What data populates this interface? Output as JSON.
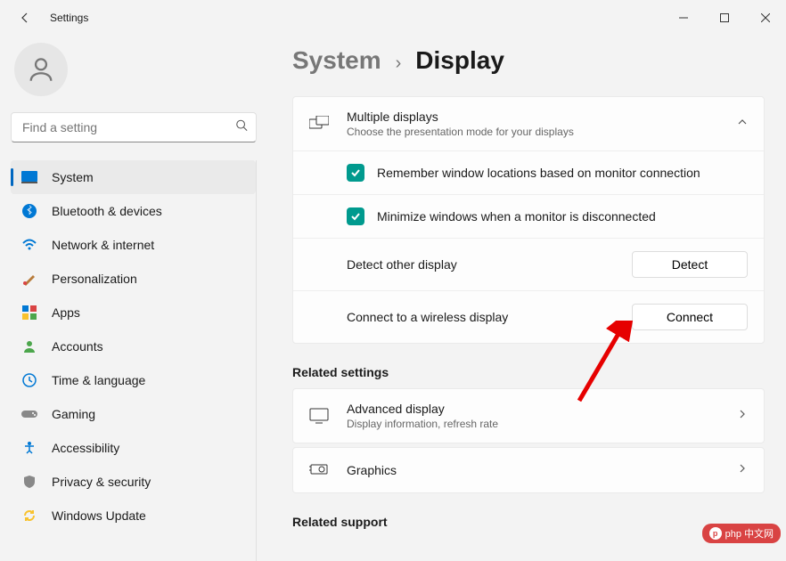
{
  "window": {
    "title": "Settings"
  },
  "search": {
    "placeholder": "Find a setting"
  },
  "nav": {
    "items": [
      {
        "label": "System"
      },
      {
        "label": "Bluetooth & devices"
      },
      {
        "label": "Network & internet"
      },
      {
        "label": "Personalization"
      },
      {
        "label": "Apps"
      },
      {
        "label": "Accounts"
      },
      {
        "label": "Time & language"
      },
      {
        "label": "Gaming"
      },
      {
        "label": "Accessibility"
      },
      {
        "label": "Privacy & security"
      },
      {
        "label": "Windows Update"
      }
    ]
  },
  "breadcrumb": {
    "parent": "System",
    "current": "Display"
  },
  "multi": {
    "title": "Multiple displays",
    "sub": "Choose the presentation mode for your displays",
    "remember": "Remember window locations based on monitor connection",
    "minimize": "Minimize windows when a monitor is disconnected",
    "detect_label": "Detect other display",
    "detect_btn": "Detect",
    "connect_label": "Connect to a wireless display",
    "connect_btn": "Connect"
  },
  "related_heading": "Related settings",
  "advanced": {
    "title": "Advanced display",
    "sub": "Display information, refresh rate"
  },
  "graphics": {
    "title": "Graphics"
  },
  "support_heading": "Related support",
  "watermark": "php 中文网"
}
